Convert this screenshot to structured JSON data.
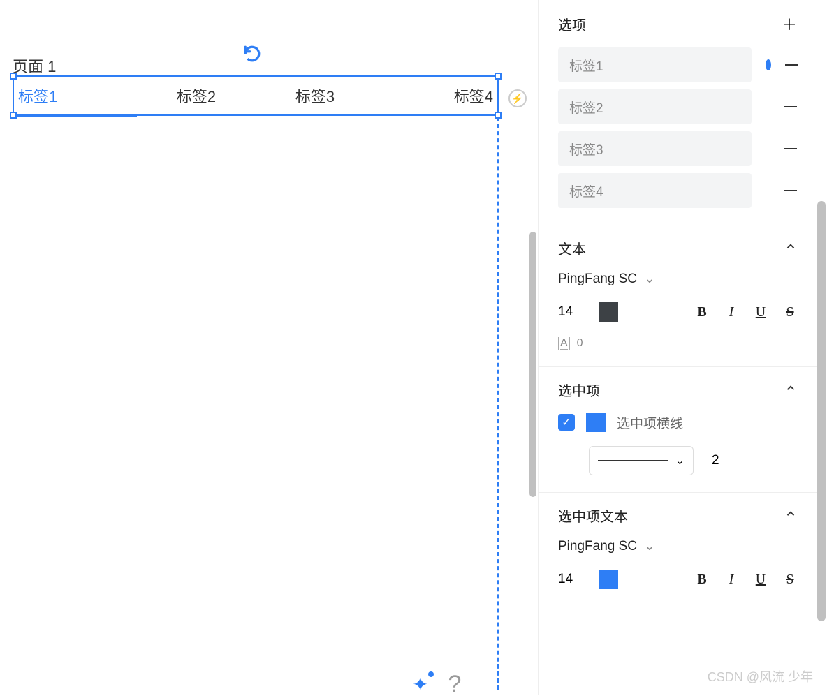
{
  "canvas": {
    "page_label": "页面 1",
    "tabs": [
      "标签1",
      "标签2",
      "标签3",
      "标签4"
    ],
    "active_tab_index": 0
  },
  "panel": {
    "options": {
      "title": "选项",
      "items": [
        "标签1",
        "标签2",
        "标签3",
        "标签4"
      ],
      "selected_index": 0
    },
    "text": {
      "title": "文本",
      "font": "PingFang SC",
      "size": "14",
      "color": "#3d4145",
      "spacing": "0"
    },
    "selected_item": {
      "title": "选中项",
      "checkbox_checked": true,
      "line_label": "选中项横线",
      "line_color": "#2e7ef5",
      "line_width": "2"
    },
    "selected_text": {
      "title": "选中项文本",
      "font": "PingFang SC",
      "size": "14",
      "color": "#2e7ef5"
    }
  },
  "glyphs": {
    "bold": "B",
    "italic": "I",
    "under": "U",
    "strike": "S",
    "check": "✓",
    "caret": "⌄",
    "qmark": "?",
    "sparkle": "✦"
  },
  "watermark": "CSDN @风流 少年"
}
